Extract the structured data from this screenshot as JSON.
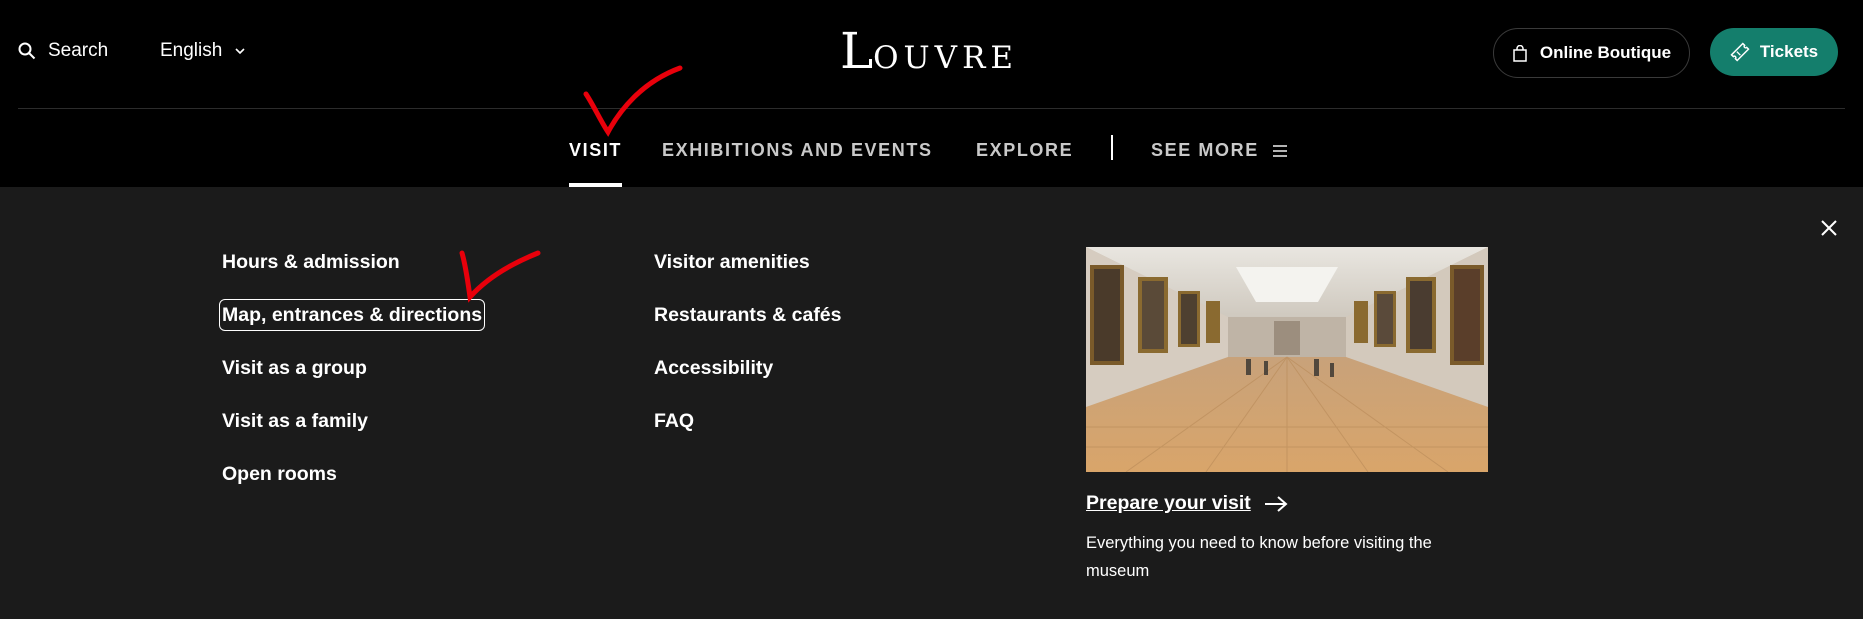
{
  "header": {
    "search_label": "Search",
    "language_label": "English",
    "logo_first": "L",
    "logo_rest": "OUVRE",
    "boutique_label": "Online Boutique",
    "tickets_label": "Tickets"
  },
  "nav": {
    "items": [
      "VISIT",
      "EXHIBITIONS AND EVENTS",
      "EXPLORE"
    ],
    "active": "VISIT",
    "see_more_label": "SEE MORE"
  },
  "panel": {
    "col1": [
      "Hours & admission",
      "Map, entrances & directions",
      "Visit as a group",
      "Visit as a family",
      "Open rooms"
    ],
    "col2": [
      "Visitor amenities",
      "Restaurants & cafés",
      "Accessibility",
      "FAQ"
    ],
    "focused_item": "Map, entrances & directions",
    "promo": {
      "link_label": "Prepare your visit",
      "description": "Everything you need to know before visiting the museum"
    }
  },
  "colors": {
    "header_bg": "#000000",
    "panel_bg": "#1b1b1b",
    "tickets_bg": "#147e6c",
    "annotation": "#e8000b"
  },
  "icons": [
    "search-icon",
    "chevron-down-icon",
    "shopping-bag-icon",
    "ticket-icon",
    "hamburger-icon",
    "close-icon",
    "arrow-right-icon"
  ]
}
